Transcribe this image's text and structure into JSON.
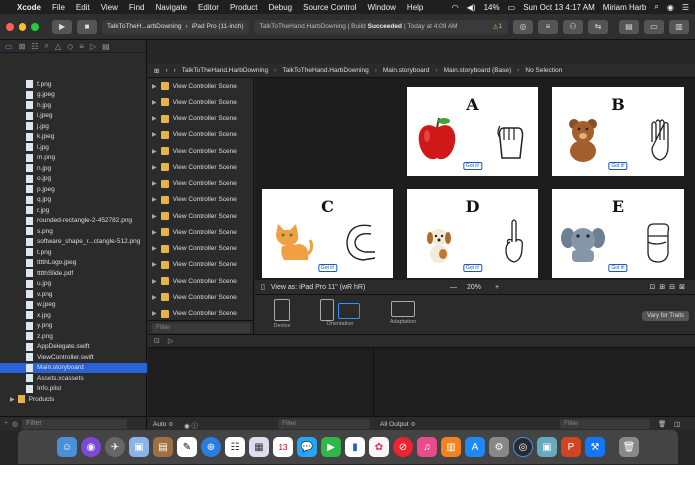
{
  "menubar": {
    "apple": "",
    "app": "Xcode",
    "items": [
      "File",
      "Edit",
      "View",
      "Find",
      "Navigate",
      "Editor",
      "Product",
      "Debug",
      "Source Control",
      "Window",
      "Help"
    ],
    "battery": "14%",
    "datetime": "Sun Oct 13  4:17 AM",
    "user": "Miriam Harb"
  },
  "toolbar": {
    "scheme": "TalkToTheH...arbDowning",
    "device": "iPad Pro (11-inch)",
    "status_prefix": "TalkToTheHand.HarbDowning | Build",
    "status_bold": "Succeeded",
    "status_suffix": "| Today at 4:09 AM",
    "warning_count": "1"
  },
  "navigator": {
    "files": [
      "f.png",
      "g.jpeg",
      "h.jpg",
      "i.jpeg",
      "j.jpg",
      "k.jpeg",
      "l.jpg",
      "m.png",
      "n.jpg",
      "o.jpg",
      "p.jpeg",
      "q.jpg",
      "r.jpg",
      "rounded-rectangle-2-452782.png",
      "s.png",
      "software_shape_r...ctangle-512.png",
      "t.png",
      "tttthLogo.jpeg",
      "tttthSlide.pdf",
      "u.jpg",
      "v.png",
      "w.jpeg",
      "x.jpg",
      "y.png",
      "z.png",
      "AppDelegate.swift",
      "ViewController.swift",
      "Main.storyboard",
      "Assets.xcassets",
      "Info.plist"
    ],
    "selected_index": 27,
    "group": "Products",
    "filter_placeholder": "Filter"
  },
  "jumpbar": {
    "crumbs": [
      "TalkToTheHand.HarbDowning",
      "TalkToTheHand.HarbDowning",
      "Main.storyboard",
      "Main.storyboard (Base)",
      "No Selection"
    ]
  },
  "outline": {
    "scenes": [
      "View Controller Scene",
      "View Controller Scene",
      "View Controller Scene",
      "View Controller Scene",
      "View Controller Scene",
      "View Controller Scene",
      "View Controller Scene",
      "View Controller Scene",
      "View Controller Scene",
      "View Controller Scene",
      "View Controller Scene",
      "View Controller Scene",
      "View Controller Scene",
      "View Controller Scene",
      "View Controller Scene"
    ],
    "filter_placeholder": "Filter"
  },
  "canvas": {
    "scenes": [
      {
        "letter": "A",
        "button": "Got it!",
        "picture": "apple"
      },
      {
        "letter": "B",
        "button": "Got it!",
        "picture": "teddy-bear"
      },
      {
        "letter": "C",
        "button": "Got it!",
        "picture": "cat"
      },
      {
        "letter": "D",
        "button": "Got it!",
        "picture": "dog"
      },
      {
        "letter": "E",
        "button": "Got it!",
        "picture": "elephant"
      }
    ],
    "view_as": "View as: iPad Pro 11\" (wR hR)",
    "zoom": "20%"
  },
  "device_config": {
    "device_label": "Device",
    "orientation_label": "Orientation",
    "adaptation_label": "Adaptation",
    "vary_button": "Vary for Traits"
  },
  "debug": {
    "auto_label": "Auto ≎",
    "filter_placeholder": "Filter",
    "output_label": "All Output ≎",
    "filter2_placeholder": "Filter"
  },
  "colors": {
    "accent": "#2b63d6",
    "folder": "#e6b34a",
    "canvas_bg": "#1d1d1d"
  }
}
